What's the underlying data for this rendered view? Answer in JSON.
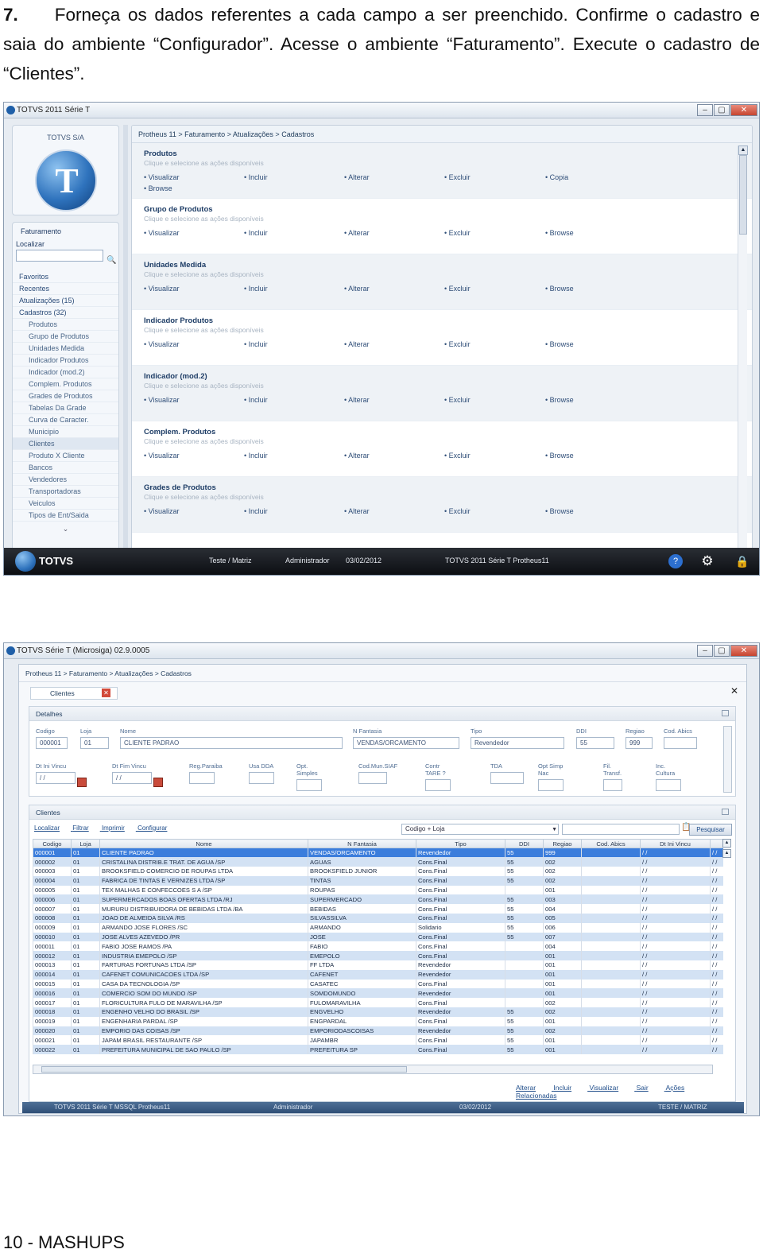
{
  "instruction": {
    "number": "7.",
    "text": "Forneça os dados referentes a cada campo a ser preenchido. Confirme o cadastro e saia do ambiente “Configurador”. Acesse o ambiente “Faturamento”. Execute o cadastro de “Clientes”."
  },
  "footer": "10 - MASHUPS",
  "shot1": {
    "window_title": "TOTVS 2011 Série T",
    "company": "TOTVS S/A",
    "nav_title": "Faturamento",
    "localizar": "Localizar",
    "menu": [
      {
        "label": "Favoritos",
        "top": true
      },
      {
        "label": "Recentes",
        "top": true
      },
      {
        "label": "Atualizações (15)",
        "top": true
      },
      {
        "label": "Cadastros (32)",
        "top": true
      },
      {
        "label": "Produtos"
      },
      {
        "label": "Grupo de Produtos"
      },
      {
        "label": "Unidades Medida"
      },
      {
        "label": "Indicador Produtos"
      },
      {
        "label": "Indicador (mod.2)"
      },
      {
        "label": "Complem. Produtos"
      },
      {
        "label": "Grades de Produtos"
      },
      {
        "label": "Tabelas Da Grade"
      },
      {
        "label": "Curva de Caracter."
      },
      {
        "label": "Municipio"
      },
      {
        "label": "Clientes",
        "selected": true
      },
      {
        "label": "Produto X Cliente"
      },
      {
        "label": "Bancos"
      },
      {
        "label": "Vendedores"
      },
      {
        "label": "Transportadoras"
      },
      {
        "label": "Veiculos"
      },
      {
        "label": "Tipos de Ent/Saida"
      }
    ],
    "breadcrumb": "Protheus 11 > Faturamento > Atualizações > Cadastros",
    "hint": "Clique e selecione as ações disponíveis",
    "sections": [
      {
        "title": "Produtos",
        "actions": [
          "Visualizar",
          "Incluir",
          "Alterar",
          "Excluir",
          "Copia"
        ],
        "extra": "Browse"
      },
      {
        "title": "Grupo de Produtos",
        "actions": [
          "Visualizar",
          "Incluir",
          "Alterar",
          "Excluir",
          "Browse"
        ]
      },
      {
        "title": "Unidades Medida",
        "actions": [
          "Visualizar",
          "Incluir",
          "Alterar",
          "Excluir",
          "Browse"
        ]
      },
      {
        "title": "Indicador Produtos",
        "actions": [
          "Visualizar",
          "Incluir",
          "Alterar",
          "Excluir",
          "Browse"
        ]
      },
      {
        "title": "Indicador (mod.2)",
        "actions": [
          "Visualizar",
          "Incluir",
          "Alterar",
          "Excluir",
          "Browse"
        ]
      },
      {
        "title": "Complem. Produtos",
        "actions": [
          "Visualizar",
          "Incluir",
          "Alterar",
          "Excluir",
          "Browse"
        ]
      },
      {
        "title": "Grades de Produtos",
        "actions": [
          "Visualizar",
          "Incluir",
          "Alterar",
          "Excluir",
          "Browse"
        ]
      }
    ],
    "taskbar": {
      "brand": "TOTVS",
      "env": "Teste / Matriz",
      "user": "Administrador",
      "date": "03/02/2012",
      "version": "TOTVS 2011 Série T  Protheus11"
    }
  },
  "shot2": {
    "window_title": "TOTVS Série T (Microsiga) 02.9.0005",
    "breadcrumb": "Protheus 11 > Faturamento > Atualizações > Cadastros",
    "tab": "Clientes",
    "details_title": "Detalhes",
    "fields": {
      "codigo": {
        "label": "Codigo",
        "value": "000001"
      },
      "loja": {
        "label": "Loja",
        "value": "01"
      },
      "nome": {
        "label": "Nome",
        "value": "CLIENTE PADRAO"
      },
      "fantasia": {
        "label": "N Fantasia",
        "value": "VENDAS/ORCAMENTO"
      },
      "tipo": {
        "label": "Tipo",
        "value": "Revendedor"
      },
      "ddi": {
        "label": "DDI",
        "value": "55"
      },
      "regiao": {
        "label": "Regiao",
        "value": "999"
      },
      "abics": {
        "label": "Cod. Abics",
        "value": ""
      },
      "dtini": {
        "label": "Dt Ini Vincu",
        "value": " / /"
      },
      "dtfim": {
        "label": "Dt Fim Vincu",
        "value": " / /"
      },
      "regparaiba": {
        "label": "Reg.Paraiba",
        "value": ""
      },
      "usadda": {
        "label": "Usa DDA",
        "value": ""
      },
      "optsimples": {
        "label": "Opt. Simples",
        "value": ""
      },
      "codmun": {
        "label": "Cod.Mun.SIAF",
        "value": ""
      },
      "tare": {
        "label": "Contr TARE ?",
        "value": ""
      },
      "tda": {
        "label": "TDA",
        "value": ""
      },
      "optsimpnac": {
        "label": "Opt Simp Nac",
        "value": ""
      },
      "fil": {
        "label": "Fil. Transf.",
        "value": ""
      },
      "cultura": {
        "label": "Inc. Cultura",
        "value": ""
      }
    },
    "grid_title": "Clientes",
    "grid_links": [
      "Localizar",
      "Filtrar",
      "Imprimir",
      "Configurar"
    ],
    "order": "Codigo + Loja",
    "search_button": "Pesquisar",
    "columns": [
      "Codigo",
      "Loja",
      "Nome",
      "N Fantasia",
      "Tipo",
      "DDI",
      "Regiao",
      "Cod. Abics",
      "Dt Ini Vincu"
    ],
    "rows": [
      [
        "000001",
        "01",
        "CLIENTE PADRAO",
        "VENDAS/ORCAMENTO",
        "Revendedor",
        "55",
        "999",
        "",
        " / /",
        " / /"
      ],
      [
        "000002",
        "01",
        "CRISTALINA DISTRIB.E TRAT. DE AGUA /SP",
        "AGUAS",
        "Cons.Final",
        "55",
        "002",
        "",
        " / /",
        " / /"
      ],
      [
        "000003",
        "01",
        "BROOKSFIELD COMERCIO DE ROUPAS LTDA",
        "BROOKSFIELD JUNIOR",
        "Cons.Final",
        "55",
        "002",
        "",
        " / /",
        " / /"
      ],
      [
        "000004",
        "01",
        "FABRICA DE TINTAS E VERNIZES LTDA /SP",
        "TINTAS",
        "Cons.Final",
        "55",
        "002",
        "",
        " / /",
        " / /"
      ],
      [
        "000005",
        "01",
        "TEX MALHAS E CONFECCOES S A /SP",
        "ROUPAS",
        "Cons.Final",
        "",
        "001",
        "",
        " / /",
        " / /"
      ],
      [
        "000006",
        "01",
        "SUPERMERCADOS BOAS OFERTAS LTDA /RJ",
        "SUPERMERCADO",
        "Cons.Final",
        "55",
        "003",
        "",
        " / /",
        " / /"
      ],
      [
        "000007",
        "01",
        "MURURU DISTRIBUIDORA DE BEBIDAS LTDA /BA",
        "BEBIDAS",
        "Cons.Final",
        "55",
        "004",
        "",
        " / /",
        " / /"
      ],
      [
        "000008",
        "01",
        "JOAO DE ALMEIDA SILVA /RS",
        "SILVASSILVA",
        "Cons.Final",
        "55",
        "005",
        "",
        " / /",
        " / /"
      ],
      [
        "000009",
        "01",
        "ARMANDO JOSE FLORES /SC",
        "ARMANDO",
        "Solidario",
        "55",
        "006",
        "",
        " / /",
        " / /"
      ],
      [
        "000010",
        "01",
        "JOSE ALVES AZEVEDO /PR",
        "JOSE",
        "Cons.Final",
        "55",
        "007",
        "",
        " / /",
        " / /"
      ],
      [
        "000011",
        "01",
        "FABIO JOSE RAMOS /PA",
        "FABIO",
        "Cons.Final",
        "",
        "004",
        "",
        " / /",
        " / /"
      ],
      [
        "000012",
        "01",
        "INDUSTRIA EMEPOLO /SP",
        "EMEPOLO",
        "Cons.Final",
        "",
        "001",
        "",
        " / /",
        " / /"
      ],
      [
        "000013",
        "01",
        "FARTURAS FORTUNAS LTDA /SP",
        "FF LTDA",
        "Revendedor",
        "",
        "001",
        "",
        " / /",
        " / /"
      ],
      [
        "000014",
        "01",
        "CAFENET COMUNICACOES LTDA /SP",
        "CAFENET",
        "Revendedor",
        "",
        "001",
        "",
        " / /",
        " / /"
      ],
      [
        "000015",
        "01",
        "CASA DA TECNOLOGIA /SP",
        "CASATEC",
        "Cons.Final",
        "",
        "001",
        "",
        " / /",
        " / /"
      ],
      [
        "000016",
        "01",
        "COMERCIO SOM DO MUNDO /SP",
        "SOMDOMUNDO",
        "Revendedor",
        "",
        "001",
        "",
        " / /",
        " / /"
      ],
      [
        "000017",
        "01",
        "FLORICULTURA FULO DE MARAVILHA /SP",
        "FULOMARAVILHA",
        "Cons.Final",
        "",
        "002",
        "",
        " / /",
        " / /"
      ],
      [
        "000018",
        "01",
        "ENGENHO VELHO DO BRASIL /SP",
        "ENGVELHO",
        "Revendedor",
        "55",
        "002",
        "",
        " / /",
        " / /"
      ],
      [
        "000019",
        "01",
        "ENGENHARIA PARDAL /SP",
        "ENGPARDAL",
        "Cons.Final",
        "55",
        "001",
        "",
        " / /",
        " / /"
      ],
      [
        "000020",
        "01",
        "EMPORIO DAS COISAS /SP",
        "EMPORIODASCOISAS",
        "Revendedor",
        "55",
        "002",
        "",
        " / /",
        " / /"
      ],
      [
        "000021",
        "01",
        "JAPAM BRASIL RESTAURANTE /SP",
        "JAPAMBR",
        "Cons.Final",
        "55",
        "001",
        "",
        " / /",
        " / /"
      ],
      [
        "000022",
        "01",
        "PREFEITURA MUNICIPAL DE SAO PAULO /SP",
        "PREFEITURA SP",
        "Cons.Final",
        "55",
        "001",
        "",
        " / /",
        " / /"
      ]
    ],
    "bottom_links": [
      "Alterar",
      "Incluir",
      "Visualizar",
      "Sair",
      "Ações Relacionadas"
    ],
    "status": {
      "version": "TOTVS 2011 Série T  MSSQL Protheus11",
      "user": "Administrador",
      "date": "03/02/2012",
      "env": "TESTE / MATRIZ"
    }
  }
}
